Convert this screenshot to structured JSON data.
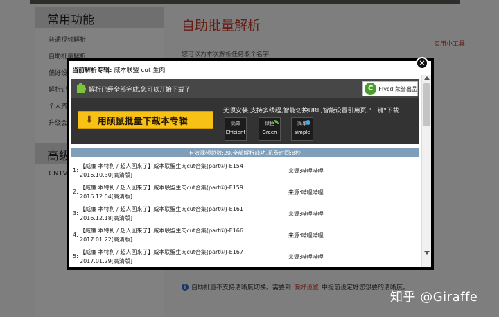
{
  "background": {
    "sidebar_title": "常用功能",
    "sidebar_items": [
      "普通视频解析",
      "自助批量解析",
      "偏好设置",
      "解析记录",
      "个人资料",
      "升级会员"
    ],
    "sidebar_title2": "高级",
    "cntv_label": "CNTV",
    "main_title": "自助批量解析",
    "tools_link": "实用小工具",
    "prompt": "您可以为本次解析任务取个名字:",
    "footnote_pre": "自助批量不支持清晰度切换。需要到",
    "footnote_link": "偏好设置",
    "footnote_post": "中提前设定好您想要的清晰度。"
  },
  "modal": {
    "album_label": "当前解析专辑:",
    "album_name": "威本联盟 cut 生肉",
    "status_text": "解析已经全部完成,您可以开始下载了",
    "flvcd_badge": "Flvcd 荣誉出品",
    "flvcd_logo_letter": "C",
    "download_button": "用硕鼠批量下载本专辑",
    "feature_text": "无须安装,支持多线程,智能切换URL,智能设置引用页,\"一键\"下载",
    "features": [
      {
        "zh": "高效",
        "en": "Efficient"
      },
      {
        "zh": "绿色",
        "en": "Green"
      },
      {
        "zh": "简单",
        "en": "simple"
      }
    ],
    "summary": "有效视频总数:20,全部解析成功,花费时间:8秒",
    "close_glyph": "×",
    "rows": [
      {
        "num": "1:",
        "title": "【威廉 本特利 / 超人回来了】威本联盟生肉cut合集(part①)-E154 2016.10.30[高清版]",
        "source": "来源:哔哩哔哩"
      },
      {
        "num": "2:",
        "title": "【威廉 本特利 / 超人回来了】威本联盟生肉cut合集(part①)-E159 2016.12.04[高清版]",
        "source": "来源:哔哩哔哩"
      },
      {
        "num": "3:",
        "title": "【威廉 本特利 / 超人回来了】威本联盟生肉cut合集(part①)-E161 2016.12.18[高清版]",
        "source": "来源:哔哩哔哩"
      },
      {
        "num": "4:",
        "title": "【威廉 本特利 / 超人回来了】威本联盟生肉cut合集(part①)-E166 2017.01.22[高清版]",
        "source": "来源:哔哩哔哩"
      },
      {
        "num": "5:",
        "title": "【威廉 本特利 / 超人回来了】威本联盟生肉cut合集(part①)-E167 2017.01.29[高清版]",
        "source": "来源:哔哩哔哩"
      }
    ]
  },
  "watermark": "知乎 @Giraffe"
}
